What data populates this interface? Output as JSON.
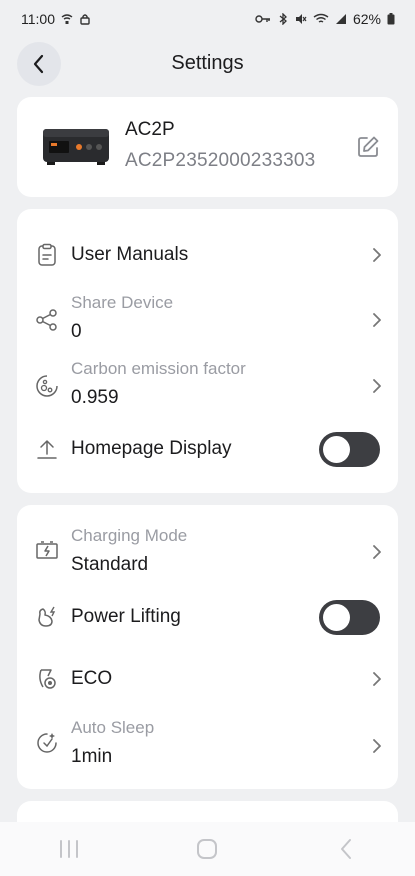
{
  "status_bar": {
    "time": "11:00",
    "battery": "62%"
  },
  "header": {
    "title": "Settings"
  },
  "device": {
    "name": "AC2P",
    "serial": "AC2P2352000233303"
  },
  "section1": {
    "user_manuals": "User Manuals",
    "share_device": {
      "label": "Share Device",
      "value": "0"
    },
    "carbon": {
      "label": "Carbon emission factor",
      "value": "0.959"
    },
    "homepage_display": {
      "label": "Homepage Display",
      "on": false
    }
  },
  "section2": {
    "charging_mode": {
      "label": "Charging Mode",
      "value": "Standard"
    },
    "power_lifting": {
      "label": "Power Lifting",
      "on": false
    },
    "eco": "ECO",
    "auto_sleep": {
      "label": "Auto Sleep",
      "value": "1min"
    }
  },
  "colors": {
    "background": "#eff0f2",
    "card": "#ffffff",
    "toggle_off": "#3d3e42",
    "muted_text": "#9a9ca3"
  }
}
